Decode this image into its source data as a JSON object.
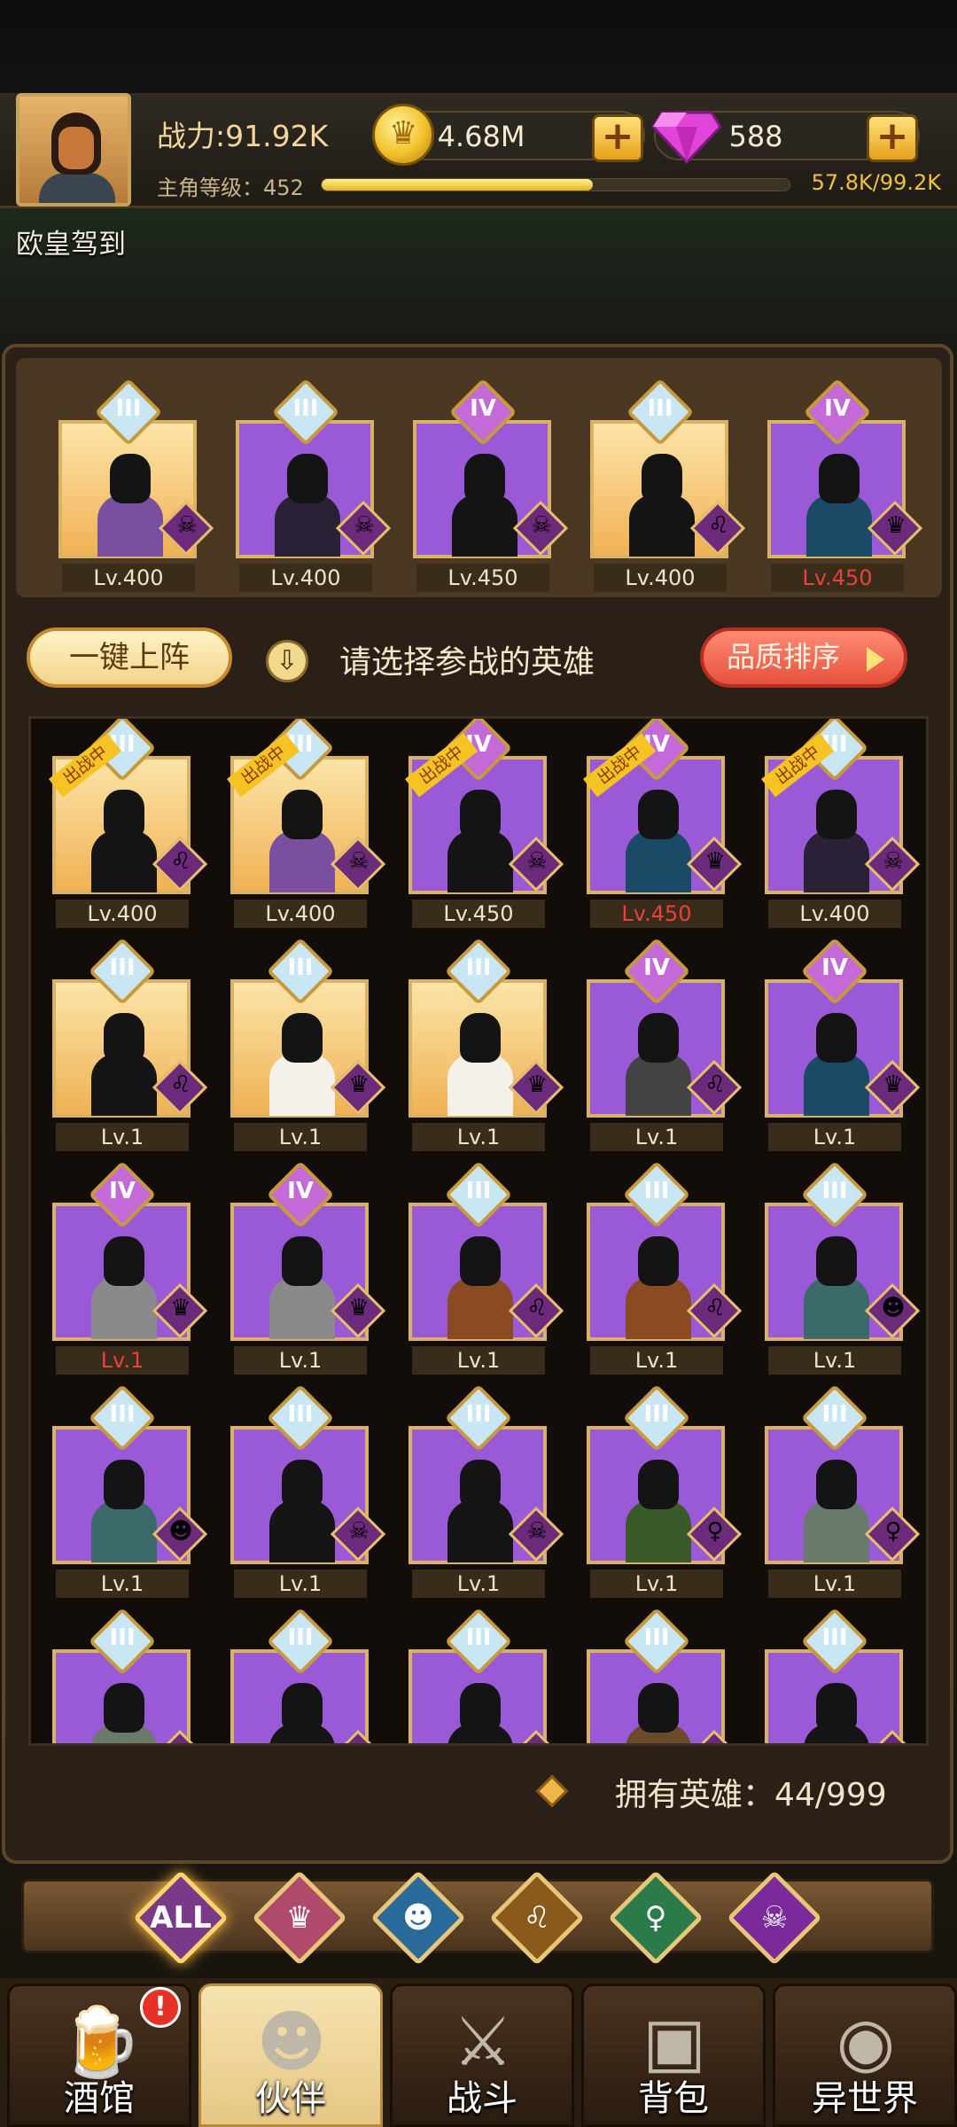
{
  "header": {
    "power": "战力:91.92K",
    "level_label": "主角等级：452",
    "exp": "57.8K/99.2K",
    "exp_progress": 0.58,
    "coins": "4.68M",
    "gems": "588",
    "checkin": "欧皇驾到"
  },
  "team": [
    {
      "rank": "III",
      "level": "Lv.400",
      "bg": "gold",
      "faction": "demon",
      "red": false,
      "skin": "#7a4fa0"
    },
    {
      "rank": "III",
      "level": "Lv.400",
      "bg": "purple",
      "faction": "demon",
      "red": false,
      "skin": "#2b2136"
    },
    {
      "rank": "IV",
      "level": "Lv.450",
      "bg": "purple",
      "faction": "demon",
      "red": false,
      "skin": "#151515"
    },
    {
      "rank": "III",
      "level": "Lv.400",
      "bg": "gold",
      "faction": "beast",
      "red": false,
      "skin": "#151515"
    },
    {
      "rank": "IV",
      "level": "Lv.450",
      "bg": "purple",
      "faction": "wing",
      "red": true,
      "skin": "#1b4a66"
    }
  ],
  "controls": {
    "deploy_button": "一键上阵",
    "hint": "请选择参战的英雄",
    "sort_button": "品质排序",
    "fighting_tag": "出战中"
  },
  "roster": [
    {
      "rank": "III",
      "level": "Lv.400",
      "bg": "gold",
      "faction": "beast",
      "red": false,
      "fighting": true,
      "skin": "#151515"
    },
    {
      "rank": "III",
      "level": "Lv.400",
      "bg": "gold",
      "faction": "demon",
      "red": false,
      "fighting": true,
      "skin": "#7a4fa0"
    },
    {
      "rank": "IV",
      "level": "Lv.450",
      "bg": "purple",
      "faction": "demon",
      "red": false,
      "fighting": true,
      "skin": "#151515"
    },
    {
      "rank": "IV",
      "level": "Lv.450",
      "bg": "purple",
      "faction": "wing",
      "red": true,
      "fighting": true,
      "skin": "#1b4a66"
    },
    {
      "rank": "III",
      "level": "Lv.400",
      "bg": "purple",
      "faction": "demon",
      "red": false,
      "fighting": true,
      "skin": "#2b2136"
    },
    {
      "rank": "III",
      "level": "Lv.1",
      "bg": "gold",
      "faction": "beast",
      "red": false,
      "fighting": false,
      "skin": "#151515"
    },
    {
      "rank": "III",
      "level": "Lv.1",
      "bg": "gold",
      "faction": "wing",
      "red": false,
      "fighting": false,
      "skin": "#f4f0ea"
    },
    {
      "rank": "III",
      "level": "Lv.1",
      "bg": "gold",
      "faction": "wing",
      "red": false,
      "fighting": false,
      "skin": "#f4f0ea"
    },
    {
      "rank": "IV",
      "level": "Lv.1",
      "bg": "purple",
      "faction": "beast",
      "red": false,
      "fighting": false,
      "skin": "#444"
    },
    {
      "rank": "IV",
      "level": "Lv.1",
      "bg": "purple",
      "faction": "wing",
      "red": false,
      "fighting": false,
      "skin": "#1b4a66"
    },
    {
      "rank": "IV",
      "level": "Lv.1",
      "bg": "purple",
      "faction": "wing",
      "red": true,
      "fighting": false,
      "skin": "#8a8a8a"
    },
    {
      "rank": "IV",
      "level": "Lv.1",
      "bg": "purple",
      "faction": "wing",
      "red": false,
      "fighting": false,
      "skin": "#8a8a8a"
    },
    {
      "rank": "III",
      "level": "Lv.1",
      "bg": "purple",
      "faction": "beast",
      "red": false,
      "fighting": false,
      "skin": "#8a4a22"
    },
    {
      "rank": "III",
      "level": "Lv.1",
      "bg": "purple",
      "faction": "beast",
      "red": false,
      "fighting": false,
      "skin": "#8a4a22"
    },
    {
      "rank": "III",
      "level": "Lv.1",
      "bg": "purple",
      "faction": "sea",
      "red": false,
      "fighting": false,
      "skin": "#3c6a6a"
    },
    {
      "rank": "III",
      "level": "Lv.1",
      "bg": "purple",
      "faction": "sea",
      "red": false,
      "fighting": false,
      "skin": "#3c6a6a"
    },
    {
      "rank": "III",
      "level": "Lv.1",
      "bg": "purple",
      "faction": "demon",
      "red": false,
      "fighting": false,
      "skin": "#151515"
    },
    {
      "rank": "III",
      "level": "Lv.1",
      "bg": "purple",
      "faction": "demon",
      "red": false,
      "fighting": false,
      "skin": "#151515"
    },
    {
      "rank": "III",
      "level": "Lv.1",
      "bg": "purple",
      "faction": "elf",
      "red": false,
      "fighting": false,
      "skin": "#3a5a2a"
    },
    {
      "rank": "III",
      "level": "Lv.1",
      "bg": "purple",
      "faction": "elf",
      "red": false,
      "fighting": false,
      "skin": "#6a7a6a"
    },
    {
      "rank": "III",
      "level": "",
      "bg": "purple",
      "faction": "elf",
      "red": false,
      "fighting": false,
      "skin": "#6a7a6a"
    },
    {
      "rank": "III",
      "level": "",
      "bg": "purple",
      "faction": "beast",
      "red": false,
      "fighting": false,
      "skin": "#151515"
    },
    {
      "rank": "III",
      "level": "",
      "bg": "purple",
      "faction": "beast",
      "red": false,
      "fighting": false,
      "skin": "#151515"
    },
    {
      "rank": "III",
      "level": "",
      "bg": "purple",
      "faction": "elf",
      "red": false,
      "fighting": false,
      "skin": "#6a4a2a"
    },
    {
      "rank": "III",
      "level": "",
      "bg": "purple",
      "faction": "sea",
      "red": false,
      "fighting": false,
      "skin": "#151515"
    }
  ],
  "owned": "拥有英雄：44/999",
  "filters": [
    {
      "name": "all",
      "label": "ALL",
      "color": "#7a3a8a"
    },
    {
      "name": "wing",
      "label": "",
      "color": "#b04a6a"
    },
    {
      "name": "sea",
      "label": "",
      "color": "#2a6a9a"
    },
    {
      "name": "beast",
      "label": "",
      "color": "#8a5a1a"
    },
    {
      "name": "elf",
      "label": "",
      "color": "#2a7a4a"
    },
    {
      "name": "demon",
      "label": "",
      "color": "#7a2a9a"
    }
  ],
  "nav": [
    {
      "name": "tavern",
      "label": "酒馆",
      "active": false
    },
    {
      "name": "partner",
      "label": "伙伴",
      "active": true
    },
    {
      "name": "battle",
      "label": "战斗",
      "active": false
    },
    {
      "name": "bag",
      "label": "背包",
      "active": false
    },
    {
      "name": "otherworld",
      "label": "异世界",
      "active": false
    }
  ],
  "notice_mark": "!",
  "faction_icons": {
    "demon": "☠",
    "beast": "♌",
    "wing": "♛",
    "sea": "☻",
    "elf": "♀"
  }
}
